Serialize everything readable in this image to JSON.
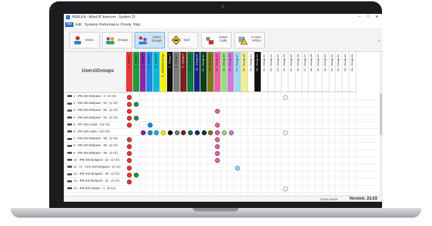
{
  "window": {
    "title": "NEBULA - Allied IP Intercom - System 23"
  },
  "menu": [
    "File",
    "Edit",
    "Systems",
    "Performance",
    "Priority",
    "Help"
  ],
  "toolbar": [
    {
      "label": "Users",
      "icon": "users-icon",
      "color": "#c0392b"
    },
    {
      "label": "Groups",
      "icon": "groups-icon",
      "color": "#8e44ad"
    },
    {
      "label": "Users Groups",
      "icon": "users-groups-icon",
      "color": "#2e86c1",
      "selected": true
    },
    {
      "label": "Quit",
      "icon": "quit-icon",
      "color": "#f1c40f"
    },
    {
      "label": "Users Calls",
      "icon": "users-calls-icon",
      "color": "#7f8c8d"
    },
    {
      "label": "C.Gen. SPDU",
      "icon": "warning-icon",
      "color": "#d4ac0d"
    }
  ],
  "grid": {
    "corner_label": "Users\\Groups",
    "columns": [
      {
        "label": "1 - Group 1",
        "color": "#e53935"
      },
      {
        "label": "2 - Group 2",
        "color": "#1e9c3a"
      },
      {
        "label": "3 - Group 3",
        "color": "#8e24aa"
      },
      {
        "label": "4 - Group 4",
        "color": "#1e88e5"
      },
      {
        "label": "5 - Group 5",
        "color": "#00bcd4"
      },
      {
        "label": "6 - IPS2000 Group",
        "color": "#f7f31a"
      },
      {
        "label": "7 - Group 7",
        "color": "#111111"
      },
      {
        "label": "8 - Group 8",
        "color": "#7b7b7b"
      },
      {
        "label": "9 - Group 9",
        "color": "#7a1f1f"
      },
      {
        "label": "10 - Group 10",
        "color": "#0d7a3a"
      },
      {
        "label": "11 - Group 11",
        "color": "#1a237e"
      },
      {
        "label": "12 - Group 12",
        "color": "#0b3d1a"
      },
      {
        "label": "13 - Group 13",
        "color": "#7d7a1c"
      },
      {
        "label": "14 - Group 14",
        "color": "#ec5fa3"
      },
      {
        "label": "15 - Group 15",
        "color": "#93e07a"
      },
      {
        "label": "16 - Group 16",
        "color": "#cc7be0"
      },
      {
        "label": "17 - Group 17",
        "color": "#9fd9f0"
      },
      {
        "label": "18 - Group 18",
        "color": "#f0ef8c"
      },
      {
        "label": "19 - Group 19",
        "color": "#ffffff"
      },
      {
        "label": "20 - Group 20",
        "color": "#111111"
      },
      {
        "label": "21 - Group 21",
        "color": "#ffffff"
      },
      {
        "label": "22 - Group 22",
        "color": "#ffffff"
      },
      {
        "label": "23 - Group 23",
        "color": "#ffffff"
      },
      {
        "label": "24 - Group 24",
        "color": "#ffffff"
      },
      {
        "label": "25 - Group 25",
        "color": "#ffffff"
      },
      {
        "label": "26 - Group 26",
        "color": "#ffffff"
      },
      {
        "label": "27 - Group 27",
        "color": "#ffffff"
      },
      {
        "label": "28 - Group 28",
        "color": "#ffffff"
      },
      {
        "label": "29 - Group 29",
        "color": "#ffffff"
      },
      {
        "label": "30 - Group 30",
        "color": "#ffffff"
      },
      {
        "label": "31 - Group 31",
        "color": "#ffffff"
      },
      {
        "label": "32 - Group 32",
        "color": "#ffffff"
      },
      {
        "label": "33 - Group 33",
        "color": "#ffffff"
      },
      {
        "label": "34 - Group 34",
        "color": "#ffffff"
      }
    ],
    "rows": [
      {
        "label": "1 - IPB-200 Beltpack - 3 - (2 Ch)",
        "members": [
          0,
          23
        ]
      },
      {
        "label": "2 - IPB-200 Beltpack - 93 - (2 Ch)",
        "members": [
          0,
          1
        ]
      },
      {
        "label": "3 - IPB-200 Beltpack - 95 - (2 Ch)",
        "members": [
          0,
          13
        ]
      },
      {
        "label": "4 - IPB-200 Beltpack - 94 - (2 Ch)",
        "members": [
          0,
          1
        ]
      },
      {
        "label": "5 - IPP-200 Assist - (16 Ch)",
        "members": [
          0,
          3,
          13
        ]
      },
      {
        "label": "6 - IPP-200 Audio - (20 Ch)",
        "members": [
          2,
          3,
          4,
          5,
          6,
          7,
          8,
          9,
          10,
          11,
          12,
          13,
          14,
          15,
          23
        ]
      },
      {
        "label": "7 - IPB-200 Beltpack - 99 - (2 Ch)",
        "members": [
          0,
          13
        ]
      },
      {
        "label": "8 - IPB-200 Beltpack - 96 - (2 Ch)",
        "members": [
          0,
          13
        ]
      },
      {
        "label": "9 - IPB-200 Beltpack - 96 - (2 Ch)",
        "members": [
          0,
          13
        ]
      },
      {
        "label": "10 - IPB-200 Beltpack - 22 - (2 Ch)",
        "members": [
          0,
          13
        ]
      },
      {
        "label": "11 - 17 - KPS-200 Beltpack - (2 Ch)",
        "members": [
          0,
          16
        ]
      },
      {
        "label": "12 - IPB-200 Beltpack - 30 - (2 Ch)",
        "members": [
          0,
          1
        ]
      },
      {
        "label": "13 - IPB-200 Beltpack - 31 - (2 Ch)",
        "members": [
          0
        ]
      },
      {
        "label": "14 - IPB-200 Station - 4 - (8 Ch)",
        "members": [
          23
        ]
      }
    ]
  },
  "status": {
    "mode": "Online Mode",
    "version": "Version: 23.03"
  }
}
